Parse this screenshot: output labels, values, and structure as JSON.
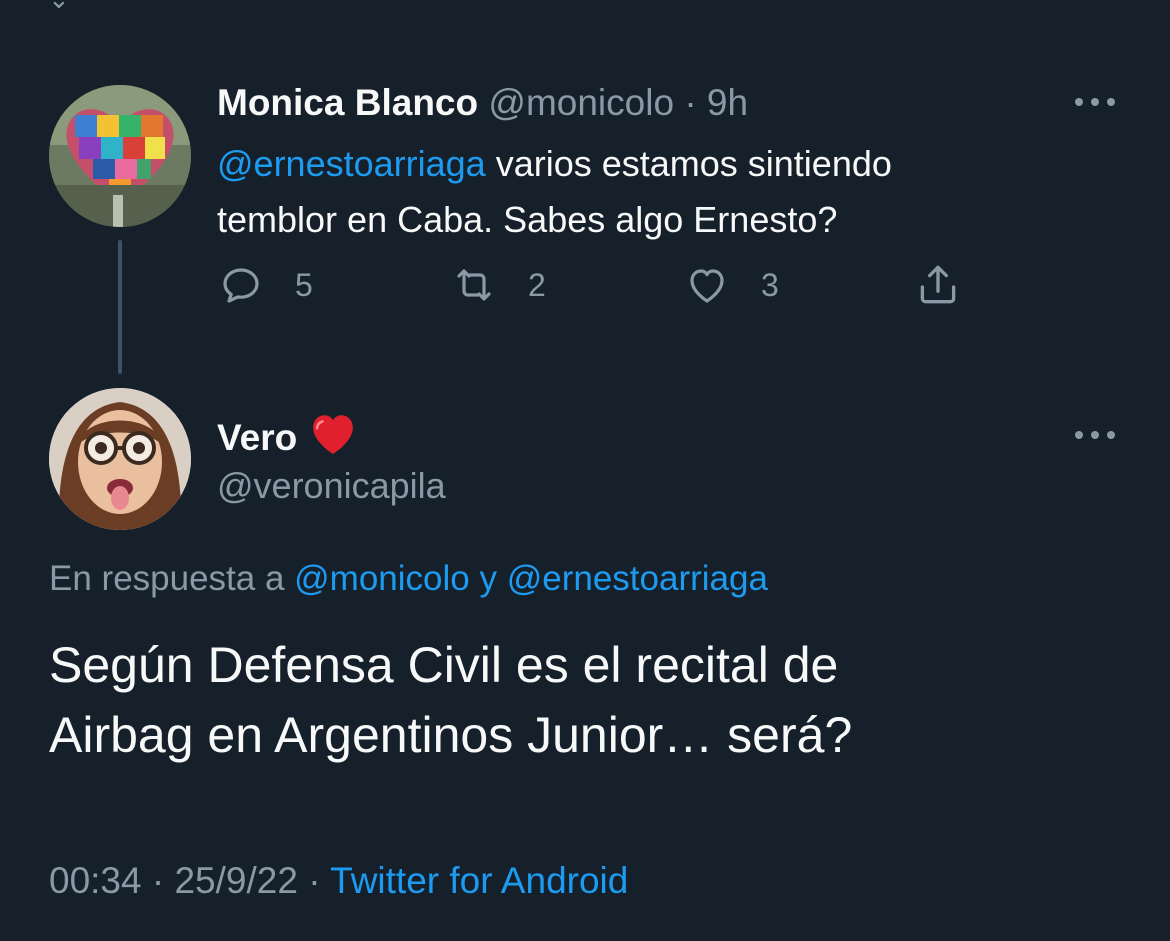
{
  "thread": {
    "parent": {
      "display_name": "Monica Blanco",
      "handle": "@monicolo",
      "separator": "·",
      "time_ago": "9h",
      "mention": "@ernestoarriaga",
      "text_line1_rest": " varios estamos sintiendo",
      "text_line2": "temblor en Caba. Sabes algo Ernesto?",
      "actions": {
        "reply_count": "5",
        "retweet_count": "2",
        "like_count": "3"
      },
      "avatar_icon": "puzzle-heart-avatar"
    },
    "reply": {
      "display_name": "Vero",
      "emoji_icon": "red-heart-emoji",
      "handle": "@veronicapila",
      "replying_prefix": "En respuesta a ",
      "replying_mention1": "@monicolo",
      "replying_joiner": " y ",
      "replying_mention2": "@ernestoarriaga",
      "text_line1": "Según Defensa Civil es el recital de",
      "text_line2": "Airbag en Argentinos Junior… será?",
      "timestamp_time": "00:34",
      "timestamp_sep1": " · ",
      "timestamp_date": "25/9/22",
      "timestamp_sep2": " · ",
      "source": "Twitter for Android",
      "avatar_icon": "woman-glasses-avatar"
    }
  },
  "colors": {
    "background": "#15202b",
    "text": "#f7f9f9",
    "muted": "#8b98a5",
    "link": "#1d9bf0",
    "thread_line": "#3d5466"
  }
}
